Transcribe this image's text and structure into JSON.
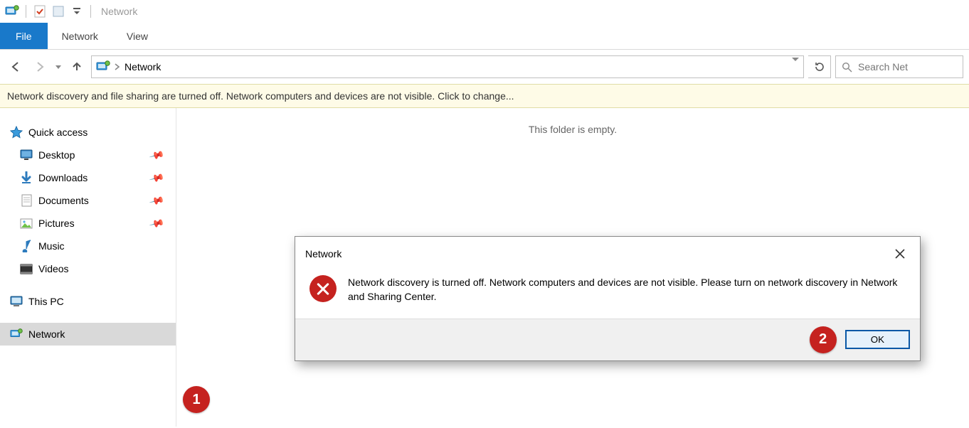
{
  "titlebar": {
    "title": "Network"
  },
  "ribbon": {
    "tabs": {
      "file": "File",
      "network": "Network",
      "view": "View"
    }
  },
  "nav": {
    "addressbar_label": "Network",
    "search_placeholder": "Search Net"
  },
  "infobar": {
    "text": "Network discovery and file sharing are turned off. Network computers and devices are not visible. Click to change..."
  },
  "sidebar": {
    "quick_access": "Quick access",
    "desktop": "Desktop",
    "downloads": "Downloads",
    "documents": "Documents",
    "pictures": "Pictures",
    "music": "Music",
    "videos": "Videos",
    "this_pc": "This PC",
    "network": "Network"
  },
  "content": {
    "empty_message": "This folder is empty."
  },
  "callouts": {
    "one": "1",
    "two": "2"
  },
  "dialog": {
    "title": "Network",
    "message": "Network discovery is turned off. Network computers and devices are not visible. Please turn on network discovery in Network and Sharing Center.",
    "ok_label": "OK"
  }
}
